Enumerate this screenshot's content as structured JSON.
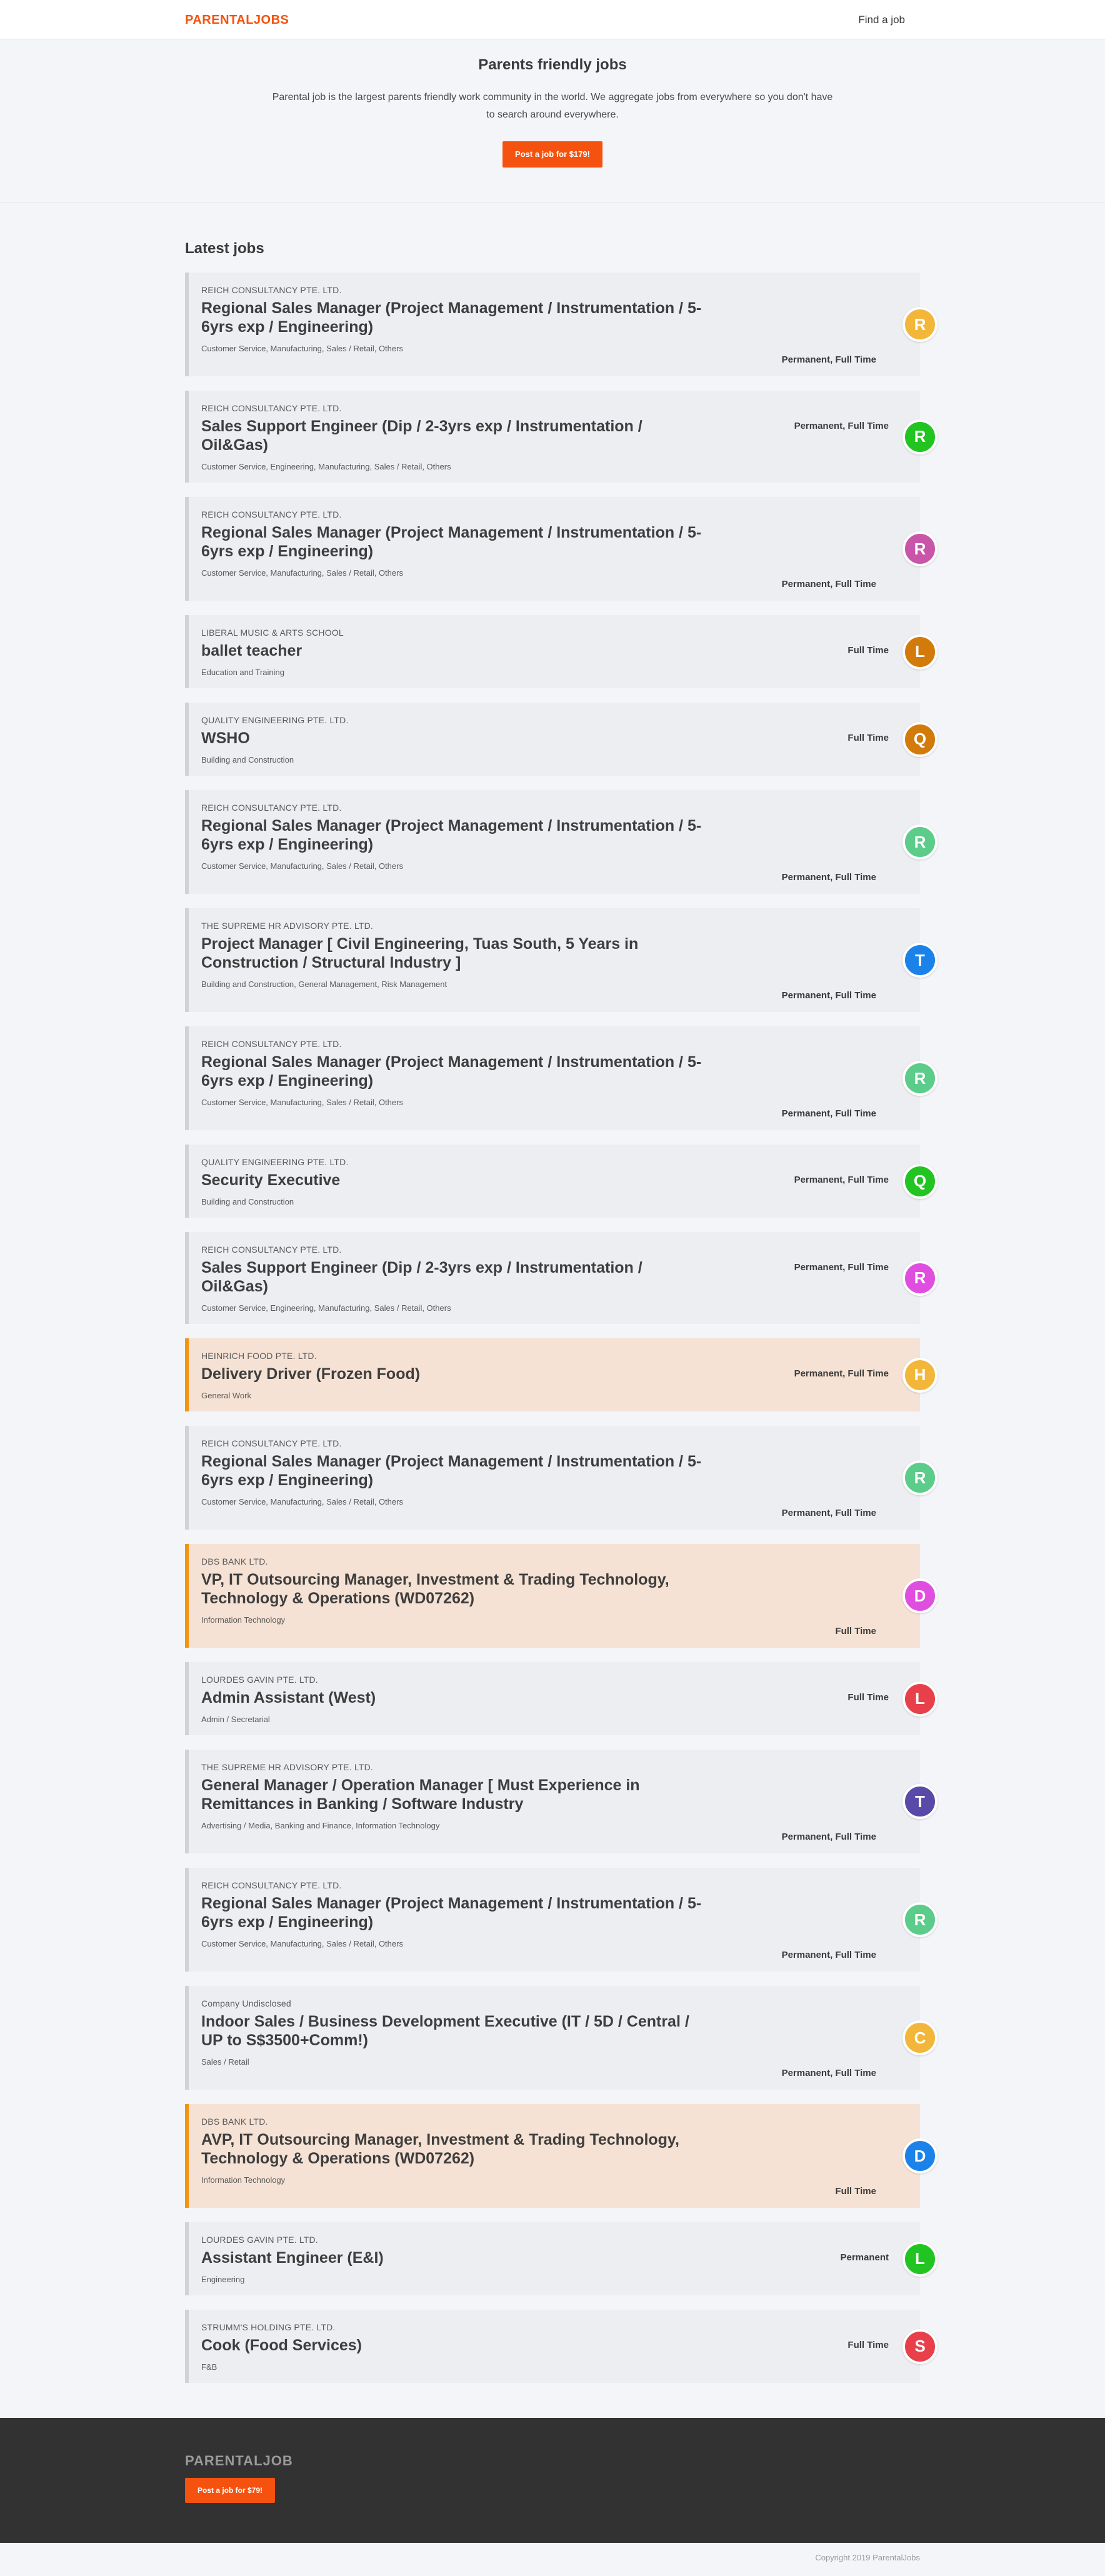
{
  "header": {
    "logo": "PARENTALJOBS",
    "nav_find": "Find a job"
  },
  "hero": {
    "title": "Parents friendly jobs",
    "description": "Parental job is the largest parents friendly work community in the world. We aggregate jobs from everywhere so you don't have to search around everywhere.",
    "post_label": "Post a job for $179!"
  },
  "jobs_section": {
    "title": "Latest jobs"
  },
  "jobs": [
    {
      "company": "REICH CONSULTANCY PTE. LTD.",
      "title": "Regional Sales Manager (Project Management / Instrumentation / 5-6yrs exp / Engineering)",
      "categories": "Customer Service, Manufacturing, Sales / Retail, Others",
      "type": "Permanent, Full Time",
      "initial": "R",
      "color": "#f2b73a",
      "highlight": false,
      "layout": "bottom"
    },
    {
      "company": "REICH CONSULTANCY PTE. LTD.",
      "title": "Sales Support Engineer (Dip / 2-3yrs exp / Instrumentation / Oil&Gas)",
      "categories": "Customer Service, Engineering, Manufacturing, Sales / Retail, Others",
      "type": "Permanent, Full Time",
      "initial": "R",
      "color": "#22c422",
      "highlight": false,
      "layout": "inline"
    },
    {
      "company": "REICH CONSULTANCY PTE. LTD.",
      "title": "Regional Sales Manager (Project Management / Instrumentation / 5-6yrs exp / Engineering)",
      "categories": "Customer Service, Manufacturing, Sales / Retail, Others",
      "type": "Permanent, Full Time",
      "initial": "R",
      "color": "#c855a8",
      "highlight": false,
      "layout": "bottom"
    },
    {
      "company": "LIBERAL MUSIC & ARTS SCHOOL",
      "title": "ballet teacher",
      "categories": "Education and Training",
      "type": "Full Time",
      "initial": "L",
      "color": "#d27a0a",
      "highlight": false,
      "layout": "inline"
    },
    {
      "company": "QUALITY ENGINEERING PTE. LTD.",
      "title": "WSHO",
      "categories": "Building and Construction",
      "type": "Full Time",
      "initial": "Q",
      "color": "#d27a0a",
      "highlight": false,
      "layout": "inline"
    },
    {
      "company": "REICH CONSULTANCY PTE. LTD.",
      "title": "Regional Sales Manager (Project Management / Instrumentation / 5-6yrs exp / Engineering)",
      "categories": "Customer Service, Manufacturing, Sales / Retail, Others",
      "type": "Permanent, Full Time",
      "initial": "R",
      "color": "#5ccc8a",
      "highlight": false,
      "layout": "bottom"
    },
    {
      "company": "THE SUPREME HR ADVISORY PTE. LTD.",
      "title": "Project Manager [ Civil Engineering, Tuas South, 5 Years in Construction / Structural Industry ]",
      "categories": "Building and Construction, General Management, Risk Management",
      "type": "Permanent, Full Time",
      "initial": "T",
      "color": "#1a82e8",
      "highlight": false,
      "layout": "bottom"
    },
    {
      "company": "REICH CONSULTANCY PTE. LTD.",
      "title": "Regional Sales Manager (Project Management / Instrumentation / 5-6yrs exp / Engineering)",
      "categories": "Customer Service, Manufacturing, Sales / Retail, Others",
      "type": "Permanent, Full Time",
      "initial": "R",
      "color": "#5ccc8a",
      "highlight": false,
      "layout": "bottom"
    },
    {
      "company": "QUALITY ENGINEERING PTE. LTD.",
      "title": "Security Executive",
      "categories": "Building and Construction",
      "type": "Permanent, Full Time",
      "initial": "Q",
      "color": "#22c422",
      "highlight": false,
      "layout": "inline"
    },
    {
      "company": "REICH CONSULTANCY PTE. LTD.",
      "title": "Sales Support Engineer (Dip / 2-3yrs exp / Instrumentation / Oil&Gas)",
      "categories": "Customer Service, Engineering, Manufacturing, Sales / Retail, Others",
      "type": "Permanent, Full Time",
      "initial": "R",
      "color": "#e04ee0",
      "highlight": false,
      "layout": "inline"
    },
    {
      "company": "HEINRICH FOOD PTE. LTD.",
      "title": "Delivery Driver (Frozen Food)",
      "categories": "General Work",
      "type": "Permanent, Full Time",
      "initial": "H",
      "color": "#f2b73a",
      "highlight": true,
      "layout": "inline"
    },
    {
      "company": "REICH CONSULTANCY PTE. LTD.",
      "title": "Regional Sales Manager (Project Management / Instrumentation / 5-6yrs exp / Engineering)",
      "categories": "Customer Service, Manufacturing, Sales / Retail, Others",
      "type": "Permanent, Full Time",
      "initial": "R",
      "color": "#5ccc8a",
      "highlight": false,
      "layout": "bottom"
    },
    {
      "company": "DBS BANK LTD.",
      "title": "VP, IT Outsourcing Manager, Investment & Trading Technology, Technology & Operations (WD07262)",
      "categories": "Information Technology",
      "type": "Full Time",
      "initial": "D",
      "color": "#e04ee0",
      "highlight": true,
      "layout": "bottom"
    },
    {
      "company": "LOURDES GAVIN PTE. LTD.",
      "title": "Admin Assistant (West)",
      "categories": "Admin / Secretarial",
      "type": "Full Time",
      "initial": "L",
      "color": "#e8404a",
      "highlight": false,
      "layout": "inline"
    },
    {
      "company": "THE SUPREME HR ADVISORY PTE. LTD.",
      "title": "General Manager / Operation Manager [ Must Experience in Remittances in Banking / Software Industry",
      "categories": "Advertising / Media, Banking and Finance, Information Technology",
      "type": "Permanent, Full Time",
      "initial": "T",
      "color": "#5a4aa8",
      "highlight": false,
      "layout": "bottom"
    },
    {
      "company": "REICH CONSULTANCY PTE. LTD.",
      "title": "Regional Sales Manager (Project Management / Instrumentation / 5-6yrs exp / Engineering)",
      "categories": "Customer Service, Manufacturing, Sales / Retail, Others",
      "type": "Permanent, Full Time",
      "initial": "R",
      "color": "#5ccc8a",
      "highlight": false,
      "layout": "bottom"
    },
    {
      "company": "Company Undisclosed",
      "title": "Indoor Sales / Business Development Executive (IT / 5D / Central / UP to S$3500+Comm!)",
      "categories": "Sales / Retail",
      "type": "Permanent, Full Time",
      "initial": "C",
      "color": "#f2b73a",
      "highlight": false,
      "layout": "bottom",
      "plain_company": true
    },
    {
      "company": "DBS BANK LTD.",
      "title": "AVP, IT Outsourcing Manager, Investment & Trading Technology, Technology & Operations (WD07262)",
      "categories": "Information Technology",
      "type": "Full Time",
      "initial": "D",
      "color": "#1a82e8",
      "highlight": true,
      "layout": "bottom"
    },
    {
      "company": "LOURDES GAVIN PTE. LTD.",
      "title": "Assistant Engineer (E&I)",
      "categories": "Engineering",
      "type": "Permanent",
      "initial": "L",
      "color": "#22c422",
      "highlight": false,
      "layout": "inline"
    },
    {
      "company": "STRUMM'S HOLDING PTE. LTD.",
      "title": "Cook (Food Services)",
      "categories": "F&B",
      "type": "Full Time",
      "initial": "S",
      "color": "#e8404a",
      "highlight": false,
      "layout": "inline"
    }
  ],
  "footer": {
    "logo": "PARENTALJOB",
    "post_label": "Post a job for $79!",
    "copyright": "Copyright 2019 ParentalJobs"
  }
}
